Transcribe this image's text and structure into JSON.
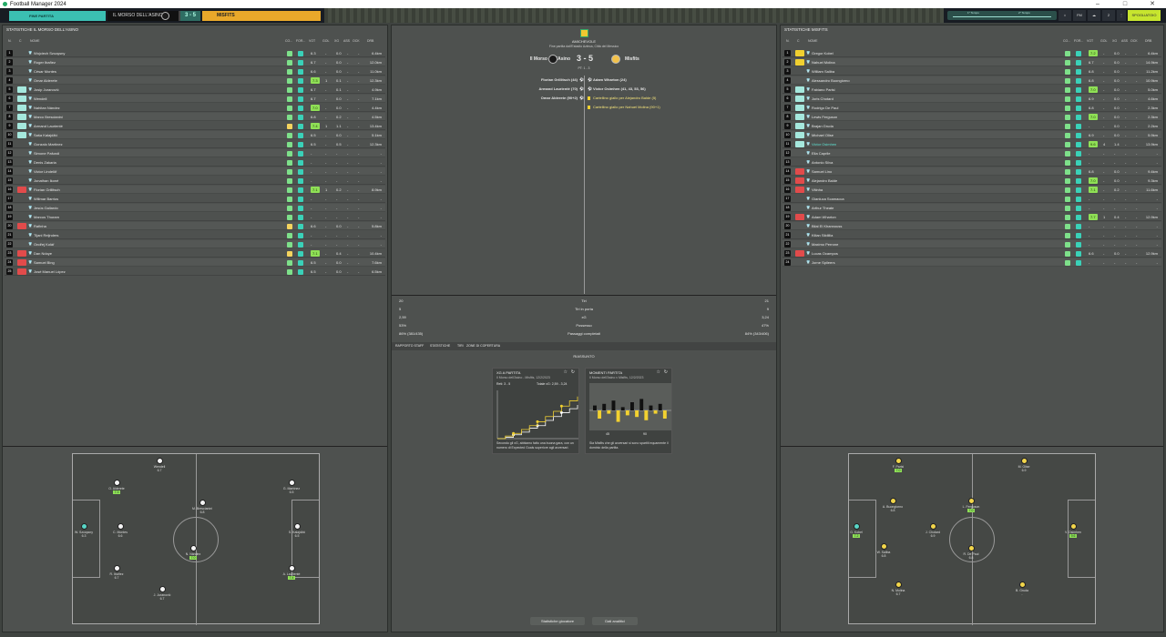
{
  "window": {
    "title": "Football Manager 2024"
  },
  "topbar": {
    "status": "FINE PARTITA",
    "home_team": "IL MORSO DELL'ASINO",
    "score": "3 - 5",
    "away_team": "MISFITS",
    "progress_labels": [
      "1° Tempo",
      "2° Tempo"
    ],
    "right_buttons": [
      "FM",
      "2",
      "SPOGLIATOIO"
    ]
  },
  "left": {
    "title": "STATISTICHE IL MORSO DELL'ASINO",
    "cols": [
      "N.",
      "C",
      "NOME",
      "CO...",
      "FOR...",
      "VOT",
      "GOL",
      "XG",
      "ASS",
      "OCK",
      "DRB"
    ],
    "rows": [
      {
        "n": "1",
        "name": "Wojciech Szczęsny",
        "vot": "6.3",
        "gol": "-",
        "xg": "0.0",
        "dist": "6.4km",
        "cond": "g",
        "pos": ""
      },
      {
        "n": "2",
        "name": "Roger Ibañez",
        "vot": "6.7",
        "gol": "-",
        "xg": "0.0",
        "dist": "12.0km",
        "cond": "g",
        "pos": ""
      },
      {
        "n": "3",
        "name": "César Montes",
        "vot": "6.6",
        "gol": "-",
        "xg": "0.0",
        "dist": "11.0km",
        "cond": "g",
        "pos": ""
      },
      {
        "n": "4",
        "name": "Omar Alderete",
        "vot": "7.3",
        "gol": "1",
        "xg": "0.1",
        "dist": "12.3km",
        "cond": "g",
        "pos": "",
        "g": true
      },
      {
        "n": "5",
        "name": "Josip Juranović",
        "vot": "6.7",
        "gol": "-",
        "xg": "0.1",
        "dist": "4.9km",
        "cond": "g",
        "pos": "c"
      },
      {
        "n": "6",
        "name": "Wendell",
        "vot": "6.7",
        "gol": "-",
        "xg": "0.0",
        "dist": "7.1km",
        "cond": "g",
        "pos": "c"
      },
      {
        "n": "7",
        "name": "Nahitan Nández",
        "vot": "7.0",
        "gol": "-",
        "xg": "0.0",
        "dist": "4.4km",
        "cond": "g",
        "pos": "c",
        "g": true
      },
      {
        "n": "8",
        "name": "Marco Brescianini",
        "vot": "6.8",
        "gol": "-",
        "xg": "0.2",
        "dist": "4.5km",
        "cond": "g",
        "pos": "c"
      },
      {
        "n": "9",
        "name": "Armand Laurienté",
        "vot": "7.4",
        "gol": "1",
        "xg": "1.1",
        "dist": "13.4km",
        "cond": "w",
        "pos": "c",
        "g": true
      },
      {
        "n": "10",
        "name": "Saša Kalajdžić",
        "vot": "6.5",
        "gol": "-",
        "xg": "0.0",
        "dist": "5.1km",
        "cond": "g",
        "pos": "c"
      },
      {
        "n": "11",
        "name": "Gonzalo Martínez",
        "vot": "6.5",
        "gol": "-",
        "xg": "0.5",
        "dist": "12.3km",
        "cond": "g",
        "pos": ""
      },
      {
        "n": "12",
        "name": "Simone Pafundi",
        "vot": "-",
        "gol": "-",
        "xg": "-",
        "dist": "-",
        "cond": "g",
        "pos": ""
      },
      {
        "n": "13",
        "name": "Denis Zakaria",
        "vot": "-",
        "gol": "-",
        "xg": "-",
        "dist": "-",
        "cond": "g",
        "pos": ""
      },
      {
        "n": "14",
        "name": "Victor Lindelöf",
        "vot": "-",
        "gol": "-",
        "xg": "-",
        "dist": "-",
        "cond": "g",
        "pos": ""
      },
      {
        "n": "15",
        "name": "Jonathan Ikoné",
        "vot": "-",
        "gol": "-",
        "xg": "-",
        "dist": "-",
        "cond": "g",
        "pos": ""
      },
      {
        "n": "16",
        "name": "Florian Grillitsch",
        "vot": "7.1",
        "gol": "1",
        "xg": "0.2",
        "dist": "8.9km",
        "cond": "g",
        "pos": "r",
        "g": true
      },
      {
        "n": "17",
        "name": "Willmar Barrios",
        "vot": "-",
        "gol": "-",
        "xg": "-",
        "dist": "-",
        "cond": "g",
        "pos": ""
      },
      {
        "n": "18",
        "name": "Jesús Gallardo",
        "vot": "-",
        "gol": "-",
        "xg": "-",
        "dist": "-",
        "cond": "g",
        "pos": ""
      },
      {
        "n": "19",
        "name": "Marcus Thuram",
        "vot": "-",
        "gol": "-",
        "xg": "-",
        "dist": "-",
        "cond": "g",
        "pos": ""
      },
      {
        "n": "20",
        "name": "Rafinha",
        "vot": "6.6",
        "gol": "-",
        "xg": "0.0",
        "dist": "5.8km",
        "cond": "w",
        "pos": "r"
      },
      {
        "n": "21",
        "name": "Tijani Reijnders",
        "vot": "-",
        "gol": "-",
        "xg": "-",
        "dist": "-",
        "cond": "g",
        "pos": ""
      },
      {
        "n": "22",
        "name": "Ondřej Kolář",
        "vot": "-",
        "gol": "-",
        "xg": "-",
        "dist": "-",
        "cond": "g",
        "pos": ""
      },
      {
        "n": "23",
        "name": "Dan Ndoye",
        "vot": "7.1",
        "gol": "-",
        "xg": "0.4",
        "dist": "10.4km",
        "cond": "w",
        "pos": "r",
        "g": true
      },
      {
        "n": "24",
        "name": "Samuel Bing",
        "vot": "6.5",
        "gol": "-",
        "xg": "0.0",
        "dist": "7.6km",
        "cond": "g",
        "pos": "r"
      },
      {
        "n": "25",
        "name": "José Manuel López",
        "vot": "6.5",
        "gol": "-",
        "xg": "0.0",
        "dist": "6.5km",
        "cond": "g",
        "pos": "r"
      }
    ],
    "pitch_players": [
      {
        "name": "Wendell",
        "rating": "6.7"
      },
      {
        "name": "O. Alderete",
        "rating": "7.3"
      },
      {
        "name": "M. Brescianini",
        "rating": "6.8"
      },
      {
        "name": "G. Martínez",
        "rating": "6.5"
      },
      {
        "name": "W. Szczęsny",
        "rating": "6.3"
      },
      {
        "name": "C. Montes",
        "rating": "6.6"
      },
      {
        "name": "S. Kalajdžić",
        "rating": "6.5"
      },
      {
        "name": "N. Nández",
        "rating": "7.0"
      },
      {
        "name": "R. Ibañez",
        "rating": "6.7"
      },
      {
        "name": "A. Laurienté",
        "rating": "7.4"
      },
      {
        "name": "J. Juranović",
        "rating": "6.7"
      }
    ]
  },
  "center": {
    "competition": "AMICHEVOLE",
    "venue": "Fine partita dall'Estadio Azteca, Città del Messico",
    "home": "Il Morso dell'Asino",
    "away": "Misfits",
    "score": "3 - 5",
    "halftime": "PT: 1 - 3",
    "home_events": [
      "Florian Grillitsch (44)",
      "Armand Laurienté (70)",
      "Omar Alderete (90+2)"
    ],
    "away_events": [
      "Adam Wharton (24)",
      "Victor Osimhen (41, 43, 53, 56)",
      "Cartellino giallo per Alejandro Balde (5)",
      "Cartellino giallo per Nahuel Molina (90+1)"
    ],
    "stats": [
      {
        "h": "20",
        "label": "Tiri",
        "a": "21"
      },
      {
        "h": "5",
        "label": "Tiri in porta",
        "a": "9"
      },
      {
        "h": "2,59",
        "label": "xG",
        "a": "3,24"
      },
      {
        "h": "53%",
        "label": "Possesso",
        "a": "47%"
      },
      {
        "h": "86% (381/435)",
        "label": "Passaggi completati",
        "a": "84% (343/406)"
      }
    ],
    "tabs": [
      "RAPPORTO STAFF",
      "STATISTICHE",
      "TIRI",
      "ZONE DI COPERTURA"
    ],
    "summary_title": "RIASSUNTO",
    "card1": {
      "title": "XG A PARTITA",
      "sub": "Il Morso dell'Asino - Misfits, 12/2/2023",
      "gol": "Reti: 3 - 5",
      "xg": "Totale xG: 2,59 - 3,24",
      "desc": "Secondo gli xG, abbiamo fatto una buona gara, con un numero di Expected Goals superiore agli avversari."
    },
    "card2": {
      "title": "MOMENTI PARTITA",
      "sub": "Il Morso dell'Asino v Misfits, 12/2/2023",
      "m1": "45",
      "m2": "90",
      "desc": "Sia Misfits che gli avversari si sono spartiti equamente il dominio della partita."
    },
    "btn_player": "Statistiche giocatore",
    "btn_data": "Dati analitici"
  },
  "right": {
    "title": "STATISTICHE MISFITS",
    "rows": [
      {
        "n": "1",
        "name": "Gregor Kobel",
        "vot": "7.2",
        "gol": "-",
        "xg": "0.0",
        "dist": "6.4km",
        "pos": "y",
        "g": true
      },
      {
        "n": "2",
        "name": "Nahuel Molina",
        "vot": "6.7",
        "gol": "-",
        "xg": "0.0",
        "dist": "14.9km",
        "pos": "y"
      },
      {
        "n": "3",
        "name": "William Saliba",
        "vot": "6.8",
        "gol": "-",
        "xg": "0.0",
        "dist": "11.2km",
        "pos": ""
      },
      {
        "n": "4",
        "name": "Alessandro Buongiorno",
        "vot": "6.8",
        "gol": "-",
        "xg": "0.0",
        "dist": "10.9km",
        "pos": ""
      },
      {
        "n": "5",
        "name": "Fabiano Parisi",
        "vot": "7.0",
        "gol": "-",
        "xg": "0.0",
        "dist": "5.0km",
        "pos": "c",
        "g": true
      },
      {
        "n": "6",
        "name": "Joris Chotard",
        "vot": "6.9",
        "gol": "-",
        "xg": "0.0",
        "dist": "4.6km",
        "pos": "c"
      },
      {
        "n": "7",
        "name": "Rodrigo De Paul",
        "vot": "6.8",
        "gol": "-",
        "xg": "0.0",
        "dist": "2.3km",
        "pos": "c"
      },
      {
        "n": "8",
        "name": "Lewis Ferguson",
        "vot": "7.0",
        "gol": "-",
        "xg": "0.0",
        "dist": "2.3km",
        "pos": "c",
        "g": true
      },
      {
        "n": "9",
        "name": "Brajan Gruda",
        "vot": "-",
        "gol": "-",
        "xg": "0.0",
        "dist": "2.2km",
        "pos": "c"
      },
      {
        "n": "10",
        "name": "Michael Olise",
        "vot": "6.9",
        "gol": "-",
        "xg": "0.0",
        "dist": "5.9km",
        "pos": "c"
      },
      {
        "n": "11",
        "name": "Victor Osimhen",
        "vot": "9.6",
        "gol": "4",
        "xg": "1.4",
        "dist": "13.9km",
        "pos": "c",
        "g": true,
        "hl": true
      },
      {
        "n": "12",
        "name": "Elia Caprile",
        "vot": "-",
        "gol": "-",
        "xg": "-",
        "dist": "-",
        "pos": ""
      },
      {
        "n": "13",
        "name": "Antonio Silva",
        "vot": "-",
        "gol": "-",
        "xg": "-",
        "dist": "-",
        "pos": ""
      },
      {
        "n": "14",
        "name": "Samuel Lino",
        "vot": "6.8",
        "gol": "-",
        "xg": "0.0",
        "dist": "9.4km",
        "pos": "r"
      },
      {
        "n": "15",
        "name": "Alejandro Balde",
        "vot": "7.0",
        "gol": "-",
        "xg": "0.0",
        "dist": "9.3km",
        "pos": "r",
        "g": true
      },
      {
        "n": "16",
        "name": "Vitinha",
        "vot": "7.1",
        "gol": "-",
        "xg": "0.2",
        "dist": "11.6km",
        "pos": "r",
        "g": true
      },
      {
        "n": "17",
        "name": "Gianluca Scamacca",
        "vot": "-",
        "gol": "-",
        "xg": "-",
        "dist": "-",
        "pos": ""
      },
      {
        "n": "18",
        "name": "Arthur Theate",
        "vot": "-",
        "gol": "-",
        "xg": "-",
        "dist": "-",
        "pos": ""
      },
      {
        "n": "19",
        "name": "Adam Wharton",
        "vot": "7.7",
        "gol": "1",
        "xg": "0.4",
        "dist": "12.9km",
        "pos": "r",
        "g": true
      },
      {
        "n": "20",
        "name": "Bilal El Khannouss",
        "vot": "-",
        "gol": "-",
        "xg": "-",
        "dist": "-",
        "pos": ""
      },
      {
        "n": "21",
        "name": "Kilian Sildillia",
        "vot": "-",
        "gol": "-",
        "xg": "-",
        "dist": "-",
        "pos": ""
      },
      {
        "n": "22",
        "name": "Maximo Perrone",
        "vot": "-",
        "gol": "-",
        "xg": "-",
        "dist": "-",
        "pos": ""
      },
      {
        "n": "23",
        "name": "Lucas Ocampos",
        "vot": "6.6",
        "gol": "-",
        "xg": "0.0",
        "dist": "12.9km",
        "pos": "r"
      },
      {
        "n": "24",
        "name": "Jorne Spileers",
        "vot": "-",
        "gol": "-",
        "xg": "-",
        "dist": "-",
        "pos": ""
      }
    ],
    "pitch_players": [
      {
        "name": "F. Parisi",
        "rating": "7.0"
      },
      {
        "name": "M. Olise",
        "rating": "6.9"
      },
      {
        "name": "A. Buongiorno",
        "rating": "6.8"
      },
      {
        "name": "L. Ferguson",
        "rating": "7.0"
      },
      {
        "name": "G. Kobel",
        "rating": "7.2"
      },
      {
        "name": "J. Chotard",
        "rating": "6.9"
      },
      {
        "name": "V. Osimhen",
        "rating": "9.6"
      },
      {
        "name": "W. Saliba",
        "rating": "6.8"
      },
      {
        "name": "R. De Paul",
        "rating": "6.8"
      },
      {
        "name": "N. Molina",
        "rating": "6.7"
      },
      {
        "name": "B. Gruda",
        "rating": "-"
      }
    ]
  },
  "chart_data": [
    {
      "type": "line",
      "title": "XG A PARTITA",
      "series": [
        {
          "values": [
            0,
            0.1,
            0.3,
            0.5,
            0.8,
            1.0,
            1.4,
            1.7,
            2.0,
            2.3,
            2.59
          ]
        },
        {
          "values": [
            0,
            0.2,
            0.4,
            0.7,
            1.0,
            1.3,
            1.7,
            2.1,
            2.5,
            2.9,
            3.24
          ]
        }
      ]
    },
    {
      "type": "bar",
      "title": "MOMENTI PARTITA",
      "values": [
        0.3,
        -0.5,
        0.4,
        -0.2,
        0.6,
        -0.7,
        0.2,
        -0.3,
        0.5,
        -0.4,
        0.7,
        -0.6,
        0.3,
        -0.2,
        0.4,
        -0.5
      ]
    }
  ]
}
